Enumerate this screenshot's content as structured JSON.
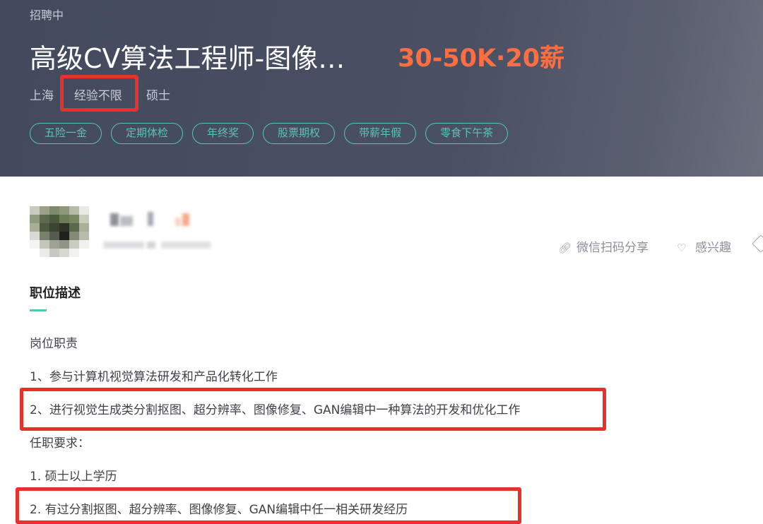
{
  "header": {
    "status": "招聘中",
    "title": "高级CV算法工程师-图像…",
    "salary": "30-50K·20薪",
    "location": "上海",
    "experience": "经验不限",
    "education": "硕士",
    "separator": "·",
    "tags": [
      "五险一金",
      "定期体检",
      "年终奖",
      "股票期权",
      "带薪年假",
      "零食下午茶"
    ]
  },
  "actions": {
    "share_label": "微信扫码分享",
    "interest_label": "感兴趣",
    "share_icon": "link-icon",
    "interest_icon": "heart-icon"
  },
  "description": {
    "section_title": "职位描述",
    "lines": [
      "岗位职责",
      "1、参与计算机视觉算法研发和产品化转化工作",
      "2、进行视觉生成类分割抠图、超分辨率、图像修复、GAN编辑中一种算法的开发和优化工作",
      "任职要求：",
      "1. 硕士以上学历",
      "2. 有过分割抠图、超分辨率、图像修复、GAN编辑中任一相关研发经历"
    ]
  },
  "colors": {
    "header_bg": "#484e62",
    "salary": "#fd6e42",
    "accent": "#58c4b2",
    "highlight": "#e8312c"
  }
}
